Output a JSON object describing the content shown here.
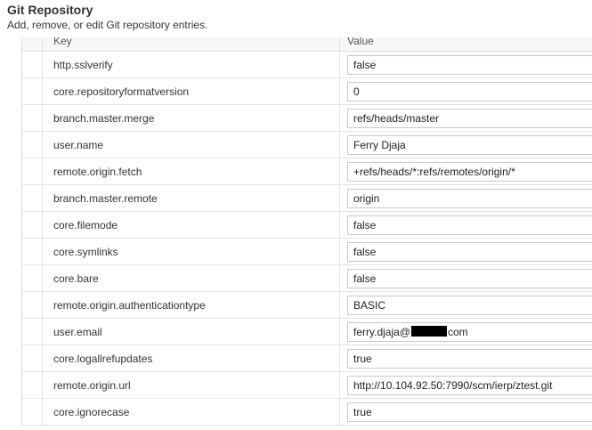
{
  "header": {
    "title": "Git Repository",
    "description": "Add, remove, or edit Git repository entries."
  },
  "table": {
    "columns": {
      "key": "Key",
      "value": "Value"
    },
    "rows": [
      {
        "key": "http.sslverify",
        "value": "false"
      },
      {
        "key": "core.repositoryformatversion",
        "value": "0"
      },
      {
        "key": "branch.master.merge",
        "value": "refs/heads/master"
      },
      {
        "key": "user.name",
        "value": "Ferry Djaja"
      },
      {
        "key": "remote.origin.fetch",
        "value": "+refs/heads/*:refs/remotes/origin/*"
      },
      {
        "key": "branch.master.remote",
        "value": "origin"
      },
      {
        "key": "core.filemode",
        "value": "false"
      },
      {
        "key": "core.symlinks",
        "value": "false"
      },
      {
        "key": "core.bare",
        "value": "false"
      },
      {
        "key": "remote.origin.authenticationtype",
        "value": "BASIC"
      },
      {
        "key": "user.email",
        "value_prefix": "ferry.djaja@",
        "value_suffix": "com"
      },
      {
        "key": "core.logallrefupdates",
        "value": "true"
      },
      {
        "key": "remote.origin.url",
        "value": "http://10.104.92.50:7990/scm/ierp/ztest.git"
      },
      {
        "key": "core.ignorecase",
        "value": "true"
      }
    ]
  }
}
